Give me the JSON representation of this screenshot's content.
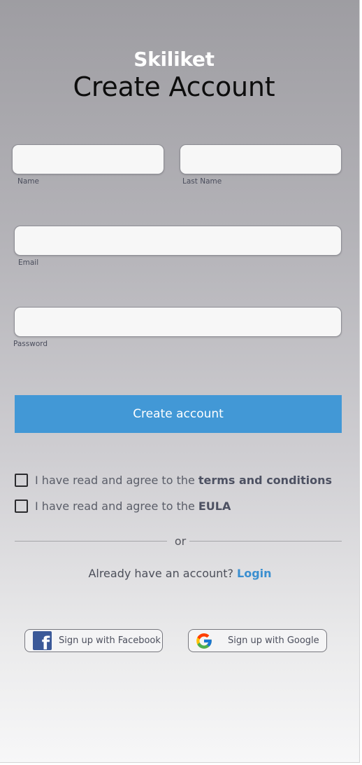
{
  "app": {
    "brand": "Skiliket",
    "title": "Create Account"
  },
  "form": {
    "first_name": {
      "label": "Name",
      "value": "",
      "placeholder": ""
    },
    "last_name": {
      "label": "Last Name",
      "value": "",
      "placeholder": ""
    },
    "email": {
      "label": "Email",
      "value": "",
      "placeholder": ""
    },
    "password": {
      "label": "Password",
      "value": "",
      "placeholder": ""
    },
    "submit_label": "Create account"
  },
  "agreements": {
    "terms": {
      "text": "I have read and agree to the",
      "link": "terms and conditions",
      "checked": false
    },
    "eula": {
      "text": "I have read and agree to the",
      "link": "EULA",
      "checked": false
    }
  },
  "divider_text": "or",
  "login": {
    "prompt": "Already have an account?",
    "link": "Login"
  },
  "social": {
    "facebook": {
      "label": "Sign up with Facebook",
      "icon": "facebook-icon"
    },
    "google": {
      "label": "Sign up with Google",
      "icon": "google-icon"
    }
  },
  "colors": {
    "accent": "#4298d6",
    "link": "#3b8fd0",
    "facebook": "#3b5998"
  }
}
